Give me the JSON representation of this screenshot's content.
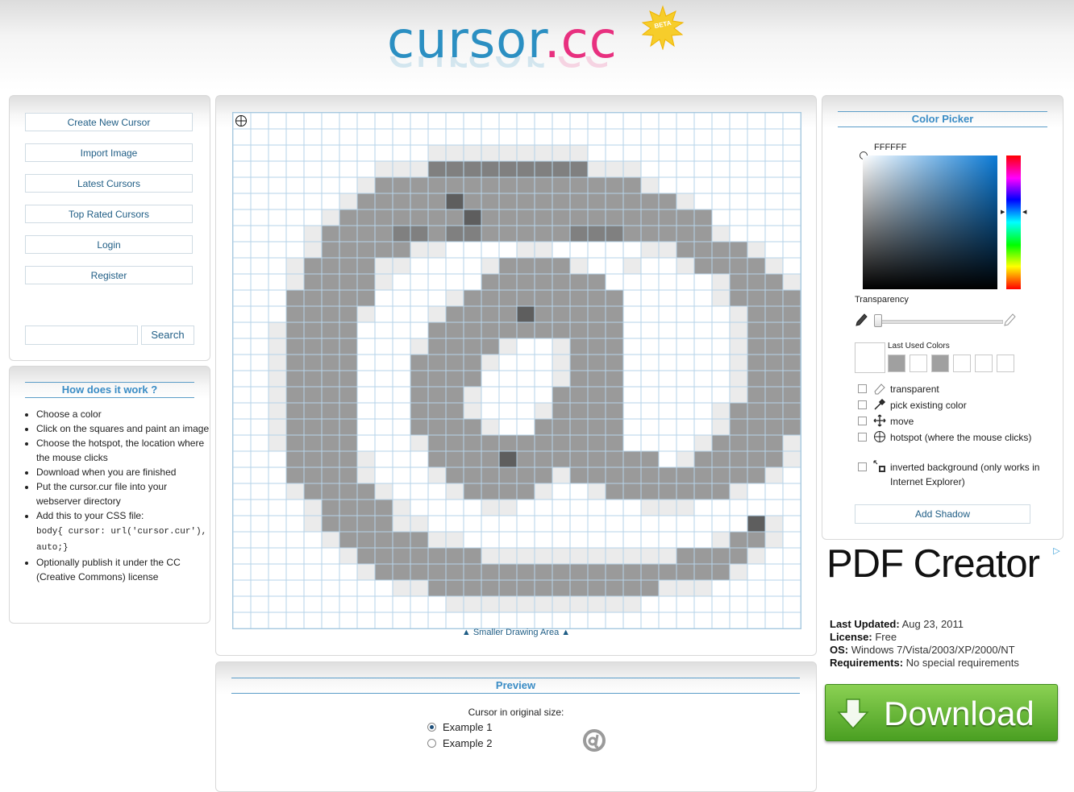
{
  "logo": {
    "part1": "cursor",
    "part2": ".cc",
    "badge": "BETA"
  },
  "sidebar": {
    "items": [
      {
        "label": "Create New Cursor"
      },
      {
        "label": "Import Image"
      },
      {
        "label": "Latest Cursors"
      },
      {
        "label": "Top Rated Cursors"
      },
      {
        "label": "Login"
      },
      {
        "label": "Register"
      }
    ],
    "search_value": "",
    "search_button": "Search"
  },
  "how": {
    "title": "How does it work ?",
    "steps": [
      "Choose a color",
      "Click on the squares and paint an image",
      "Choose the hotspot, the location where the mouse clicks",
      "Download when you are finished",
      "Put the cursor.cur file into your webserver directory",
      "Add this to your CSS file:",
      "Optionally publish it under the CC (Creative Commons) license"
    ],
    "code": "body{ cursor: url('cursor.cur'), auto;}"
  },
  "editor": {
    "smaller_link": "Smaller Drawing Area",
    "rows": [
      "................................",
      "................................",
      "...........LLLLLLLLL............",
      "........LLLDDDDDDDDDLLL.........",
      ".......LMMMMMMMMMMMMMMML........",
      "......LMMMMMKMMMMMMMMMMMML......",
      ".....LMMMMMMMKMMMMMMMMMMMMM.....",
      "....LMMMMDDMDDMMMMMDDDMMMMML....",
      "....LMMMMMLL....LL.....LLMMMML...",
      "...LMMMMLL....LMMMML..L..LMMMML..",
      "...LMMMML.....MMMMMMM......LMMML.",
      "...MMMMM....LMMMMMMMMM.....LMMMM.",
      "...MMMML...LMMMMKMMMMM......LMMM.",
      "..LMMMM....MMMMMMMMMMM......LMMM.",
      "..LMMMM...LMMMML..LMMM......LMMML",
      "..LMMMM...MMMML...LMMM......LMMML",
      "..LMMMM...MMMM....LMMM......LMMML",
      "..LMMMM...MMML....MMMM......LMMML",
      "..LMMMM...MMML...LMMMM.....LMMMML",
      "..LMMMM...MMMML..MMMMM.....LMMMM.",
      "..LMMMM...LMMMMMMMMMMM....LMMMML.",
      "...MMMML...MMMMKMMMMMMMM.LMMMMML.",
      "...MMMML...LMMMMMMLMMMMMMMMMMML..",
      "...LMMMML...LMMMML..LMMMMMMML....",
      "....LMMMML....LL.......LLL.......",
      "....LMMMMLL..................KL..",
      ".....LMMMMMLL..............LMML..",
      "......LMMMMMMMLLLLLLLLLLLMMMML...",
      ".......LMMMMMMMMMMMMMMMMMMMML....",
      ".........LLMMMMMMMMMMMMMLLL......",
      "............LLLLLLLLLLL.........",
      "................................"
    ]
  },
  "picker": {
    "title": "Color Picker",
    "hex": "FFFFFF",
    "transparency_label": "Transparency",
    "last_used_label": "Last Used Colors",
    "last_used": [
      "#a0a0a0",
      "#ffffff",
      "#a0a0a0",
      "#ffffff",
      "#ffffff",
      "#ffffff"
    ],
    "options": [
      {
        "label": "transparent",
        "icon": "eraser-icon"
      },
      {
        "label": "pick existing color",
        "icon": "eyedropper-icon"
      },
      {
        "label": "move",
        "icon": "move-icon"
      },
      {
        "label": "hotspot (where the mouse clicks)",
        "icon": "crosshair-icon"
      },
      {
        "label": "inverted background (only works in Internet Explorer)",
        "icon": "inverted-icon"
      }
    ],
    "add_shadow": "Add Shadow"
  },
  "ad": {
    "title": "PDF Creator",
    "info": [
      {
        "k": "Last Updated:",
        "v": " Aug 23, 2011"
      },
      {
        "k": "License:",
        "v": " Free"
      },
      {
        "k": "OS:",
        "v": " Windows 7/Vista/2003/XP/2000/NT"
      },
      {
        "k": "Requirements:",
        "v": " No special requirements"
      }
    ],
    "button": "Download"
  },
  "preview": {
    "title": "Preview",
    "caption": "Cursor in original size:",
    "examples": [
      "Example 1",
      "Example 2"
    ],
    "selected": 0
  },
  "colors": {
    "accent": "#3a8cc5",
    "grid_line": "#b6d3e8",
    "pixel_light": "#ebebeb",
    "pixel_mid": "#9a9a9a",
    "pixel_dark": "#808080",
    "pixel_darkest": "#5e5e5e"
  }
}
